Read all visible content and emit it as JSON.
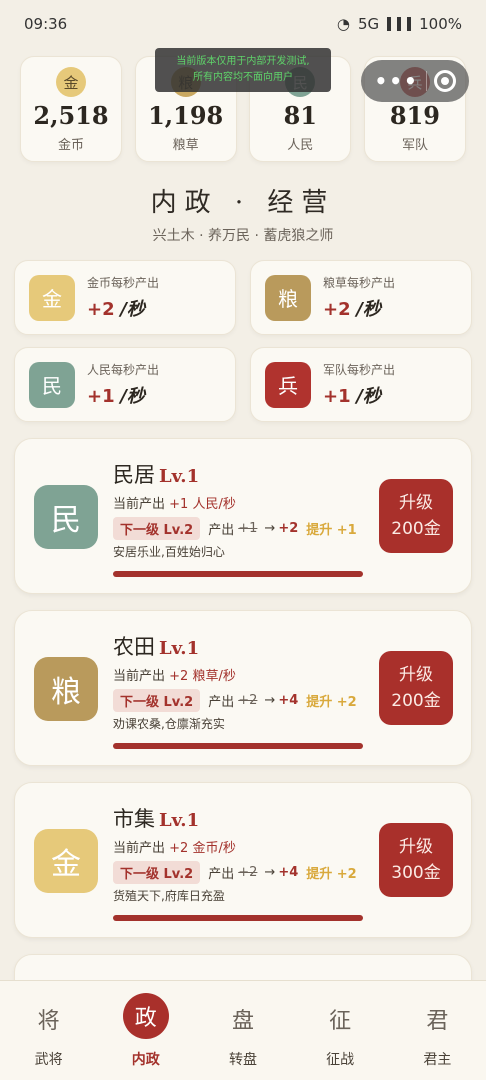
{
  "status_bar": {
    "time": "09:36",
    "network": "5G",
    "battery": "100%"
  },
  "dev_notice": {
    "line1": "当前版本仅用于内部开发测试,",
    "line2": "所有内容均不面向用户"
  },
  "resources": [
    {
      "icon": "金",
      "value": "2,518",
      "label": "金币",
      "color": "#e6c97a"
    },
    {
      "icon": "粮",
      "value": "1,198",
      "label": "粮草",
      "color": "#c9a861"
    },
    {
      "icon": "民",
      "value": "81",
      "label": "人民",
      "color": "#7fa394"
    },
    {
      "icon": "兵",
      "value": "819",
      "label": "军队",
      "color": "#b0332e"
    }
  ],
  "header": {
    "title": "内政 · 经营",
    "subtitle": "兴土木 · 养万民 · 蓄虎狼之师"
  },
  "rates": [
    {
      "icon": "金",
      "label": "金币每秒产出",
      "value": "+2",
      "unit": "/秒",
      "color": "#e6c97a"
    },
    {
      "icon": "粮",
      "label": "粮草每秒产出",
      "value": "+2",
      "unit": "/秒",
      "color": "#b99a5c"
    },
    {
      "icon": "民",
      "label": "人民每秒产出",
      "value": "+1",
      "unit": "/秒",
      "color": "#7fa394"
    },
    {
      "icon": "兵",
      "label": "军队每秒产出",
      "value": "+1",
      "unit": "/秒",
      "color": "#b0332e"
    }
  ],
  "buildings": [
    {
      "icon": "民",
      "name": "民居",
      "level": "Lv.1",
      "current_prefix": "当前产出",
      "current_value": "+1 人民/秒",
      "next_tag": "下一级 Lv.2",
      "next_label": "产出",
      "next_old": "+1",
      "next_arrow": "→",
      "next_new": "+2",
      "boost": "提升 +1",
      "desc": "安居乐业,百姓始归心",
      "button_line1": "升级",
      "button_line2": "200金",
      "color": "#7fa394",
      "progress": 1.0
    },
    {
      "icon": "粮",
      "name": "农田",
      "level": "Lv.1",
      "current_prefix": "当前产出",
      "current_value": "+2 粮草/秒",
      "next_tag": "下一级 Lv.2",
      "next_label": "产出",
      "next_old": "+2",
      "next_arrow": "→",
      "next_new": "+4",
      "boost": "提升 +2",
      "desc": "劝课农桑,仓廪渐充实",
      "button_line1": "升级",
      "button_line2": "200金",
      "color": "#b99a5c",
      "progress": 1.0
    },
    {
      "icon": "金",
      "name": "市集",
      "level": "Lv.1",
      "current_prefix": "当前产出",
      "current_value": "+2 金币/秒",
      "next_tag": "下一级 Lv.2",
      "next_label": "产出",
      "next_old": "+2",
      "next_arrow": "→",
      "next_new": "+4",
      "boost": "提升 +2",
      "desc": "货殖天下,府库日充盈",
      "button_line1": "升级",
      "button_line2": "300金",
      "color": "#e6c97a",
      "progress": 1.0
    }
  ],
  "nav": [
    {
      "glyph": "将",
      "label": "武将",
      "active": false
    },
    {
      "glyph": "政",
      "label": "内政",
      "active": true
    },
    {
      "glyph": "盘",
      "label": "转盘",
      "active": false
    },
    {
      "glyph": "征",
      "label": "征战",
      "active": false
    },
    {
      "glyph": "君",
      "label": "君主",
      "active": false
    }
  ]
}
